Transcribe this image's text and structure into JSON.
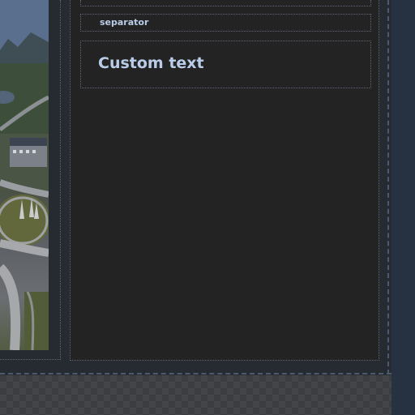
{
  "editor": {
    "separator_label": "separator",
    "text_block_heading": "Custom text"
  },
  "photo": {
    "description": "aerial-landscape"
  },
  "colors": {
    "canvas_bg": "#262a31",
    "content_bg": "#232323",
    "text_accent": "#b9cde8",
    "dashed_border": "#4d5a6e",
    "right_rail": "#263242"
  }
}
